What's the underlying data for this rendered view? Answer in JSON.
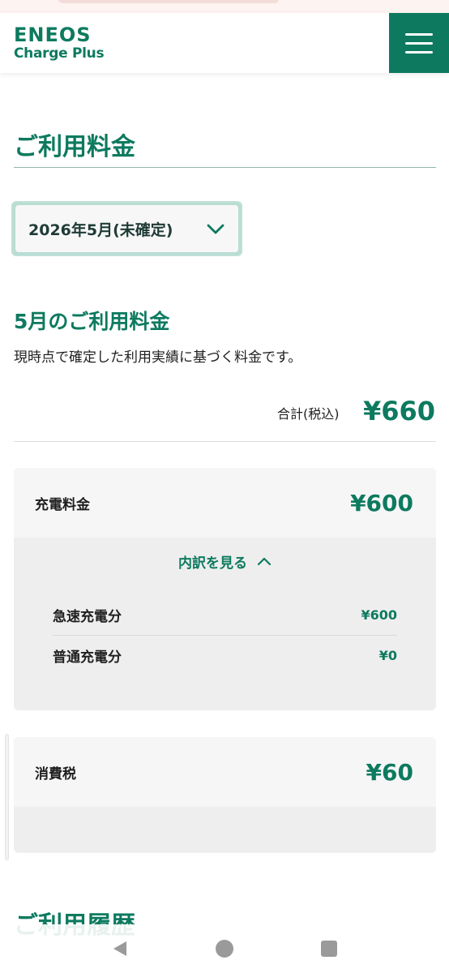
{
  "header": {
    "logo_line1": "ENEOS",
    "logo_line2": "Charge Plus",
    "menu_icon": "hamburger-menu-icon"
  },
  "page": {
    "title": "ご利用料金",
    "month_select": {
      "value": "2026年5月(未確定)",
      "icon": "chevron-down-icon"
    }
  },
  "summary": {
    "title": "5月のご利用料金",
    "description": "現時点で確定した利用実績に基づく料金です。",
    "total_label": "合計(税込)",
    "total_value": "¥660"
  },
  "charge_card": {
    "label": "充電料金",
    "amount": "¥600",
    "toggle_label": "内訳を見る",
    "toggle_icon": "chevron-up-icon",
    "breakdown": [
      {
        "label": "急速充電分",
        "amount": "¥600"
      },
      {
        "label": "普通充電分",
        "amount": "¥0"
      }
    ]
  },
  "tax_card": {
    "label": "消費税",
    "amount": "¥60"
  },
  "next_section": {
    "title": "ご利用履歴"
  },
  "system_nav": {
    "back": "back-triangle-icon",
    "home": "home-circle-icon",
    "recents": "recents-square-icon"
  },
  "colors": {
    "brand": "#0d7a5f",
    "card_bg": "#eeeeee",
    "card_head_bg": "#f6f6f6"
  }
}
